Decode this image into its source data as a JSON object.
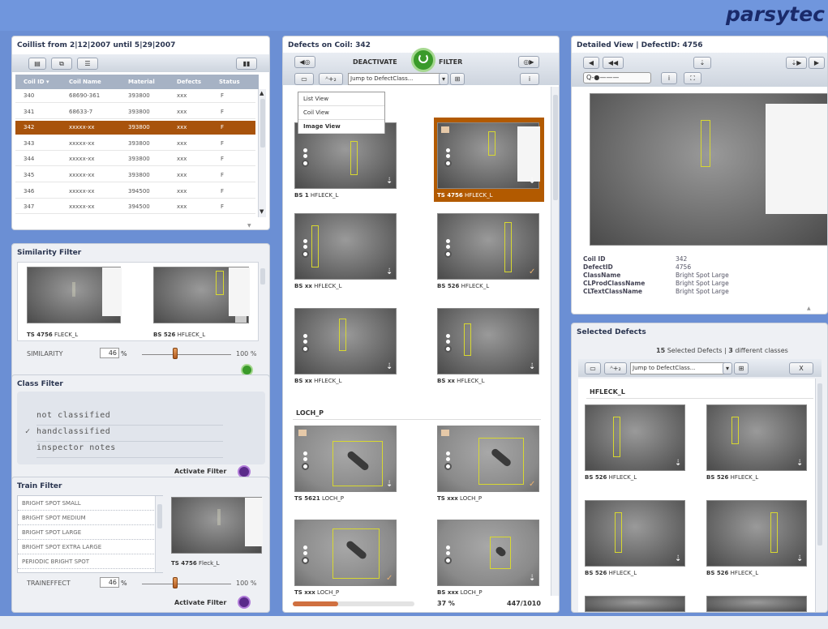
{
  "brand": {
    "logo": "parsytec"
  },
  "coillist": {
    "title": "Coillist from 2|12|2007 until 5|29|2007",
    "columns": [
      "Coil ID ▾",
      "Coil Name",
      "Material",
      "Defects",
      "Status"
    ],
    "rows": [
      [
        "340",
        "68690-361",
        "393800",
        "xxx",
        "F"
      ],
      [
        "341",
        "68633-7",
        "393800",
        "xxx",
        "F"
      ],
      [
        "342",
        "xxxxx-xx",
        "393800",
        "xxx",
        "F"
      ],
      [
        "343",
        "xxxxx-xx",
        "393800",
        "xxx",
        "F"
      ],
      [
        "344",
        "xxxxx-xx",
        "393800",
        "xxx",
        "F"
      ],
      [
        "345",
        "xxxxx-xx",
        "393800",
        "xxx",
        "F"
      ],
      [
        "346",
        "xxxxx-xx",
        "394500",
        "xxx",
        "F"
      ],
      [
        "347",
        "xxxxx-xx",
        "394500",
        "xxx",
        "F"
      ]
    ],
    "selected_index": 2
  },
  "similarity": {
    "title": "Similarity Filter",
    "thumb_a_caption_id": "TS 4756",
    "thumb_a_caption_class": "FLECK_L",
    "thumb_b_caption_id": "BS 526",
    "thumb_b_caption_class": "HFLECK_L",
    "label": "SIMILARITY",
    "value": "46",
    "unit": "%",
    "max_label": "100 %",
    "level": 0.46
  },
  "classfilter": {
    "title": "Class Filter",
    "items": [
      "not classified",
      "handclassified",
      "inspector notes"
    ],
    "checked_index": 1,
    "checkmark": "✓",
    "activate_label": "Activate Filter"
  },
  "trainfilter": {
    "title": "Train Filter",
    "items": [
      "BRIGHT SPOT SMALL",
      "BRIGHT SPOT MEDIUM",
      "BRIGHT SPOT LARGE",
      "BRIGHT SPOT EXTRA LARGE",
      "PERIODIC BRIGHT SPOT"
    ],
    "thumb_caption_id": "TS 4756",
    "thumb_caption_class": "Fleck_L",
    "label": "TRAINEFFECT",
    "value": "46",
    "unit": "%",
    "max_label": "100 %",
    "level": 0.46,
    "activate_label": "Activate Filter"
  },
  "defects": {
    "title": "Defects on Coil: 342",
    "deactivate": "DEACTIVATE",
    "filter": "FILTER",
    "jump_placeholder": "Jump to DefectClass...",
    "sort_btn": "ᴬ+₂",
    "menu": [
      "List View",
      "Coil View",
      "Image View"
    ],
    "active_view_index": 2,
    "section2": "LOCH_P",
    "captions": [
      {
        "id": "BS 1",
        "cls": "HFLECK_L"
      },
      {
        "id": "TS 4756",
        "cls": "HFLECK_L"
      },
      {
        "id": "BS xx",
        "cls": "HFLECK_L"
      },
      {
        "id": "BS 526",
        "cls": "HFLECK_L"
      },
      {
        "id": "BS xx",
        "cls": "HFLECK_L"
      },
      {
        "id": "BS xx",
        "cls": "HFLECK_L"
      },
      {
        "id": "TS 5621",
        "cls": "LOCH_P"
      },
      {
        "id": "TS xxx",
        "cls": "LOCH_P"
      },
      {
        "id": "TS xxx",
        "cls": "LOCH_P"
      },
      {
        "id": "BS xxx",
        "cls": "LOCH_P"
      }
    ],
    "progress_label": "37 %",
    "progress": 0.37,
    "count": "447/1010"
  },
  "detailed": {
    "title": "Detailed View | DefectID: 4756",
    "fields": [
      {
        "k": "Coil ID",
        "v": "342"
      },
      {
        "k": "DefectID",
        "v": "4756"
      },
      {
        "k": "ClassName",
        "v": "Bright Spot Large"
      },
      {
        "k": "CLProdClassName",
        "v": "Bright Spot Large"
      },
      {
        "k": "CLTextClassName",
        "v": "Bright Spot Large"
      }
    ]
  },
  "selected": {
    "title": "Selected Defects",
    "summary_count": "15",
    "summary_text1": "Selected Defects |",
    "summary_classes": "3",
    "summary_text2": "different classes",
    "jump_placeholder": "Jump to DefectClass...",
    "close": "X",
    "group": "HFLECK_L",
    "captions": [
      {
        "id": "BS 526",
        "cls": "HFLECK_L"
      },
      {
        "id": "BS 526",
        "cls": "HFLECK_L"
      },
      {
        "id": "BS 526",
        "cls": "HFLECK_L"
      },
      {
        "id": "BS 526",
        "cls": "HFLECK_L"
      }
    ]
  }
}
